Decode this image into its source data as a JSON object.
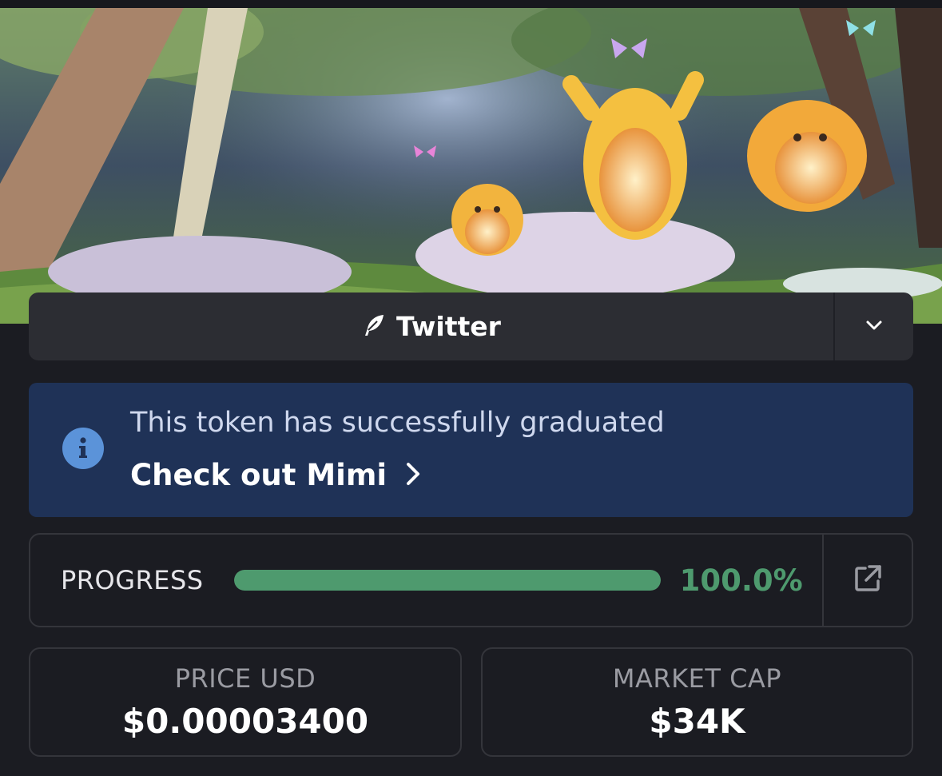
{
  "social": {
    "label": "Twitter",
    "icon": "feather-icon",
    "toggle_icon": "chevron-down-icon"
  },
  "notice": {
    "icon": "info-icon",
    "message": "This token has successfully graduated",
    "link_label": "Check out Mimi",
    "link_icon": "chevron-right-icon",
    "background": "#1f3257"
  },
  "progress": {
    "label": "PROGRESS",
    "percent": 100.0,
    "value_text": "100.0%",
    "color": "#4e9a6e",
    "link_icon": "external-link-icon"
  },
  "stats": {
    "price": {
      "label": "PRICE USD",
      "value": "$0.00003400"
    },
    "market_cap": {
      "label": "MARKET CAP",
      "value": "$34K"
    }
  }
}
